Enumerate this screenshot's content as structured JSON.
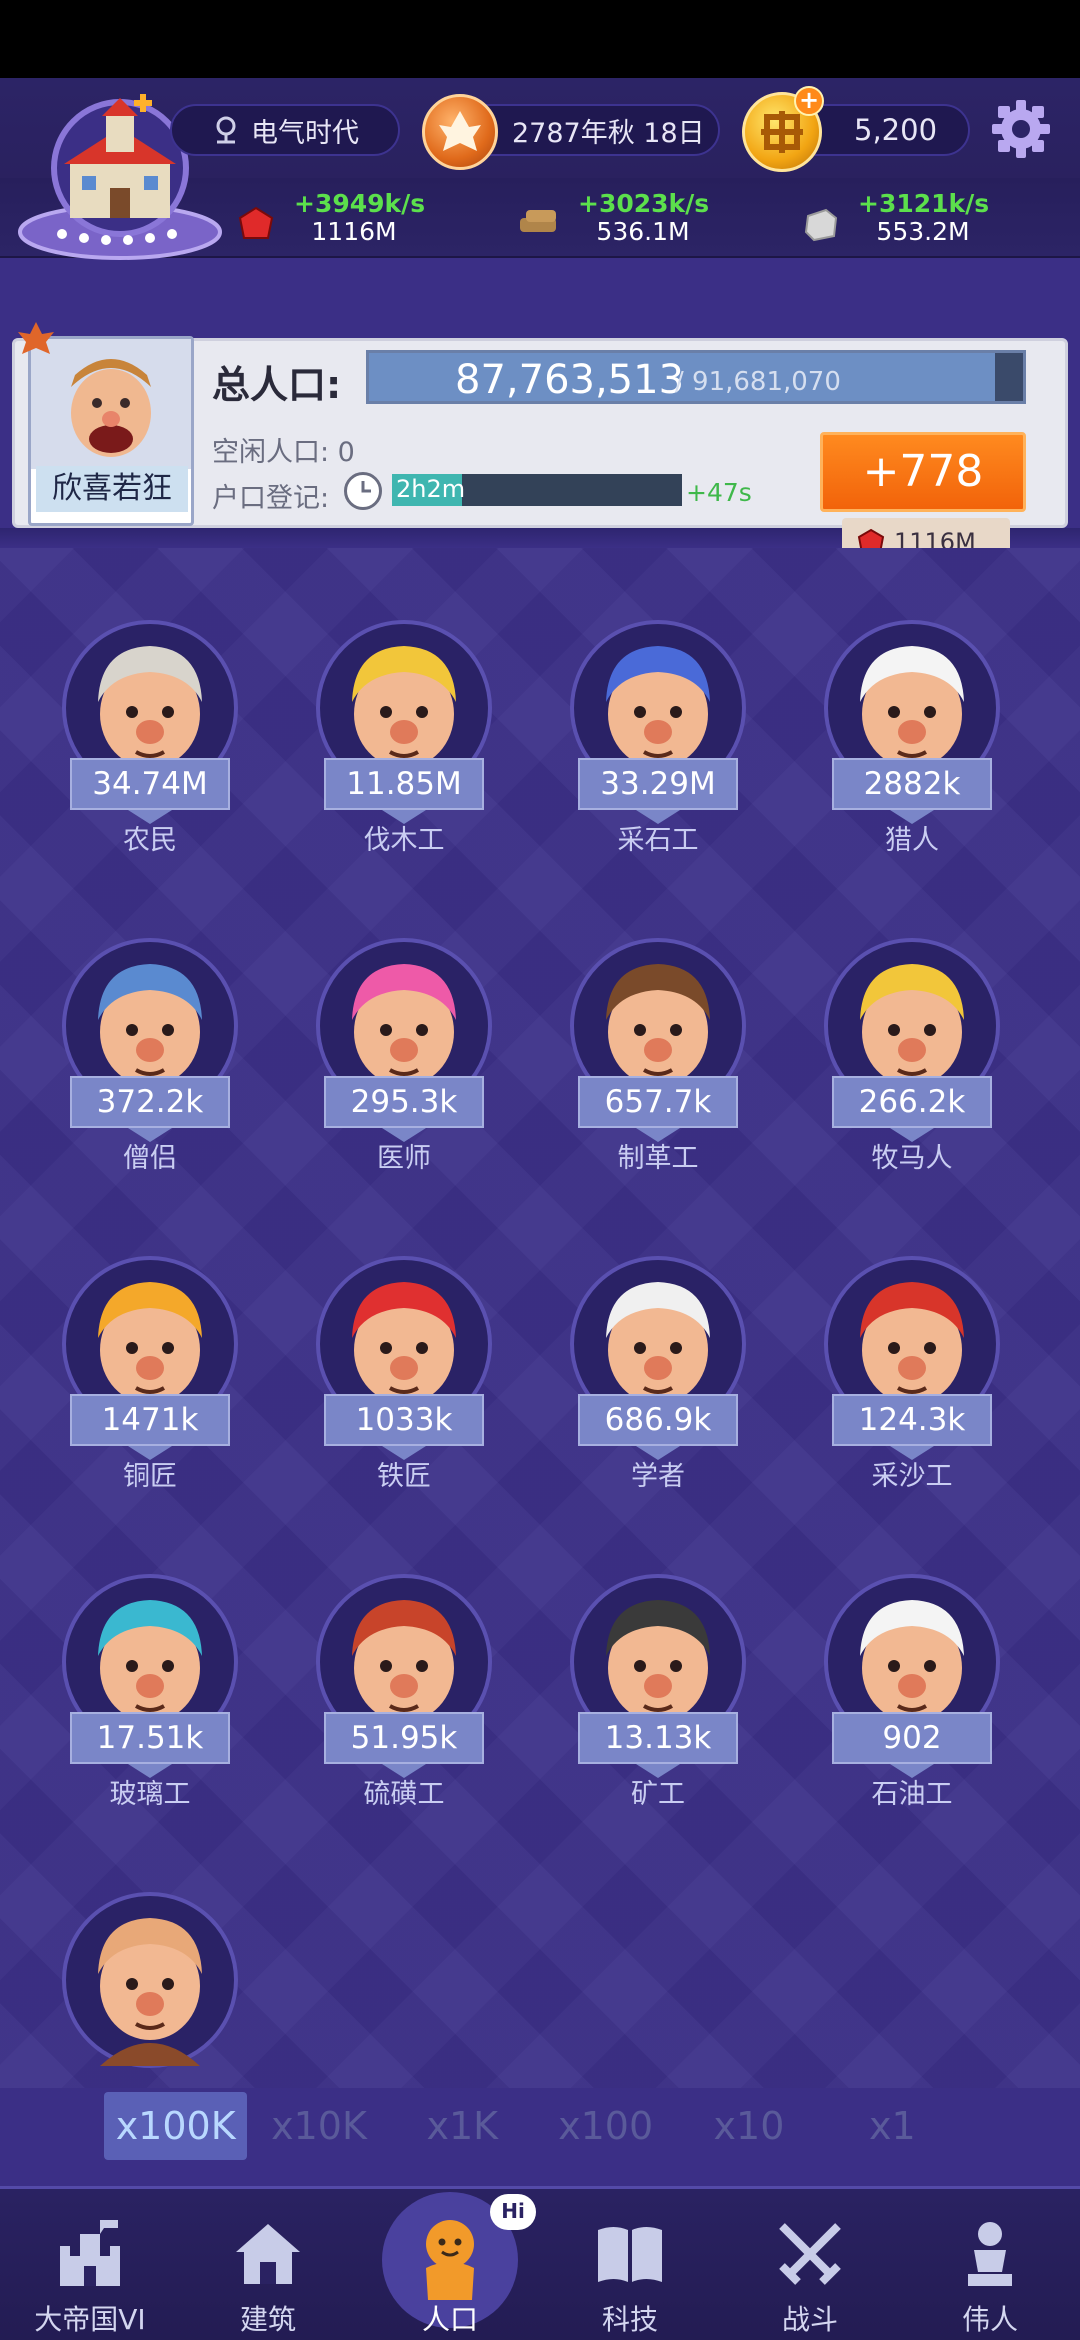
{
  "header": {
    "era": "电气时代",
    "date": "2787年秋 18日",
    "coins": "5,200"
  },
  "resources": [
    {
      "rate": "+3949k/s",
      "amount": "1116M",
      "icon": "red-gem-icon"
    },
    {
      "rate": "+3023k/s",
      "amount": "536.1M",
      "icon": "wood-log-icon"
    },
    {
      "rate": "+3121k/s",
      "amount": "553.2M",
      "icon": "stone-block-icon"
    }
  ],
  "population": {
    "mood": "欣喜若狂",
    "total_label": "总人口:",
    "total": "87,763,513",
    "max": "/ 91,681,070",
    "fill_fraction": 0.957,
    "idle_label": "空闲人口: 0",
    "register_label": "户口登记:",
    "register_time": "2h2m",
    "register_rate": "+47s",
    "add_button": "+778",
    "add_cost": "1116M"
  },
  "workers": [
    {
      "name": "农民",
      "count": "34.74M",
      "hair": "#d8d4cc",
      "shirt": "#d63a2a"
    },
    {
      "name": "伐木工",
      "count": "11.85M",
      "hair": "#f2c63a",
      "shirt": "#8a5a2a"
    },
    {
      "name": "采石工",
      "count": "33.29M",
      "hair": "#4a6ad8",
      "shirt": "#4a6ad8"
    },
    {
      "name": "猎人",
      "count": "2882k",
      "hair": "#f4f4f4",
      "shirt": "#f0e8e0"
    },
    {
      "name": "僧侣",
      "count": "372.2k",
      "hair": "#5a8ad0",
      "shirt": "#5a8ad0"
    },
    {
      "name": "医师",
      "count": "295.3k",
      "hair": "#ee5aa8",
      "shirt": "#5ac85a"
    },
    {
      "name": "制革工",
      "count": "657.7k",
      "hair": "#7a4a2a",
      "shirt": "#e8542a"
    },
    {
      "name": "牧马人",
      "count": "266.2k",
      "hair": "#f2c63a",
      "shirt": "#6a4aa8"
    },
    {
      "name": "铜匠",
      "count": "1471k",
      "hair": "#f4a82a",
      "shirt": "#3a5aa8"
    },
    {
      "name": "铁匠",
      "count": "1033k",
      "hair": "#e03030",
      "shirt": "#3a5aa8"
    },
    {
      "name": "学者",
      "count": "686.9k",
      "hair": "#f0f0f0",
      "shirt": "#5a8ad0"
    },
    {
      "name": "采沙工",
      "count": "124.3k",
      "hair": "#d8352a",
      "shirt": "#4a3a3a"
    },
    {
      "name": "玻璃工",
      "count": "17.51k",
      "hair": "#3ab8d0",
      "shirt": "#3a5aa8"
    },
    {
      "name": "硫磺工",
      "count": "51.95k",
      "hair": "#c8442a",
      "shirt": "#5a3a2a"
    },
    {
      "name": "矿工",
      "count": "13.13k",
      "hair": "#3a3a3a",
      "shirt": "#3a3a4a"
    },
    {
      "name": "石油工",
      "count": "902",
      "hair": "#f4f4f4",
      "shirt": "#f0f0f0"
    },
    {
      "name": "",
      "count": "",
      "hair": "#e8a878",
      "shirt": "#8a4a2a"
    }
  ],
  "multipliers": {
    "options": [
      "x100K",
      "x10K",
      "x1K",
      "x100",
      "x10",
      "x1"
    ],
    "selected": "x100K"
  },
  "nav": [
    {
      "label": "大帝国VI",
      "icon": "castle-icon"
    },
    {
      "label": "建筑",
      "icon": "house-icon"
    },
    {
      "label": "人口",
      "icon": "population-icon",
      "badge": "Hi"
    },
    {
      "label": "科技",
      "icon": "book-icon"
    },
    {
      "label": "战斗",
      "icon": "swords-icon"
    },
    {
      "label": "伟人",
      "icon": "statue-icon"
    }
  ]
}
